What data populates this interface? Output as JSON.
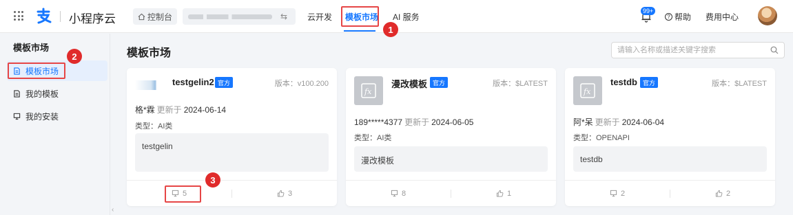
{
  "header": {
    "brand": "小程序云",
    "console_label": "控制台",
    "nav": [
      {
        "label": "云开发"
      },
      {
        "label": "模板市场"
      },
      {
        "label": "AI 服务"
      }
    ],
    "notification_badge": "99+",
    "help_label": "帮助",
    "fee_label": "费用中心"
  },
  "sidebar": {
    "title": "模板市场",
    "items": [
      {
        "label": "模板市场",
        "icon": "document-icon",
        "active": true
      },
      {
        "label": "我的模板",
        "icon": "document-icon"
      },
      {
        "label": "我的安装",
        "icon": "monitor-icon"
      }
    ]
  },
  "main": {
    "title": "模板市场",
    "search_placeholder": "请输入名称或描述关键字搜索"
  },
  "cards": [
    {
      "name": "testgelin2",
      "badge": "官方",
      "version": "版本：v100.200",
      "author": "格*霖",
      "updated_label": "更新于",
      "updated": "2024-06-14",
      "type": "类型：AI类",
      "desc": "testgelin",
      "installs": "5",
      "likes": "3"
    },
    {
      "name": "漫改模板",
      "badge": "官方",
      "version": "版本：$LATEST",
      "author": "189*****4377",
      "updated_label": "更新于",
      "updated": "2024-06-05",
      "type": "类型：AI类",
      "desc": "漫改模板",
      "installs": "8",
      "likes": "1"
    },
    {
      "name": "testdb",
      "badge": "官方",
      "version": "版本：$LATEST",
      "author": "阿*呆",
      "updated_label": "更新于",
      "updated": "2024-06-04",
      "type": "类型：OPENAPI",
      "desc": "testdb",
      "installs": "2",
      "likes": "2"
    }
  ],
  "callouts": [
    "1",
    "2",
    "3"
  ],
  "colors": {
    "accent": "#1677ff",
    "callout": "#e02b2b"
  }
}
